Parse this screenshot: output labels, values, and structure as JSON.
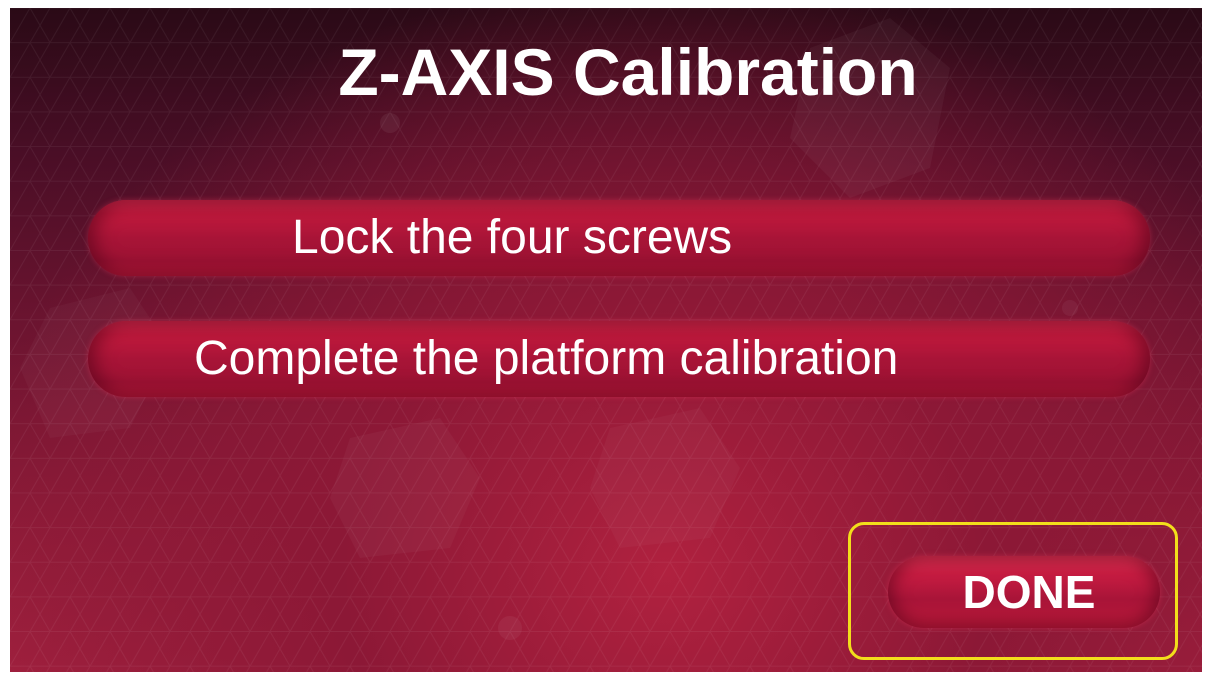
{
  "screen": {
    "title": "Z-AXIS Calibration",
    "steps": [
      {
        "label": "Lock the four screws"
      },
      {
        "label": "Complete the platform calibration"
      }
    ],
    "done_label": "DONE"
  },
  "colors": {
    "background_dark": "#2a0a16",
    "background_mid": "#8c1836",
    "button_red": "#c41a3e",
    "highlight_frame": "#f2de1b",
    "text": "#ffffff"
  }
}
